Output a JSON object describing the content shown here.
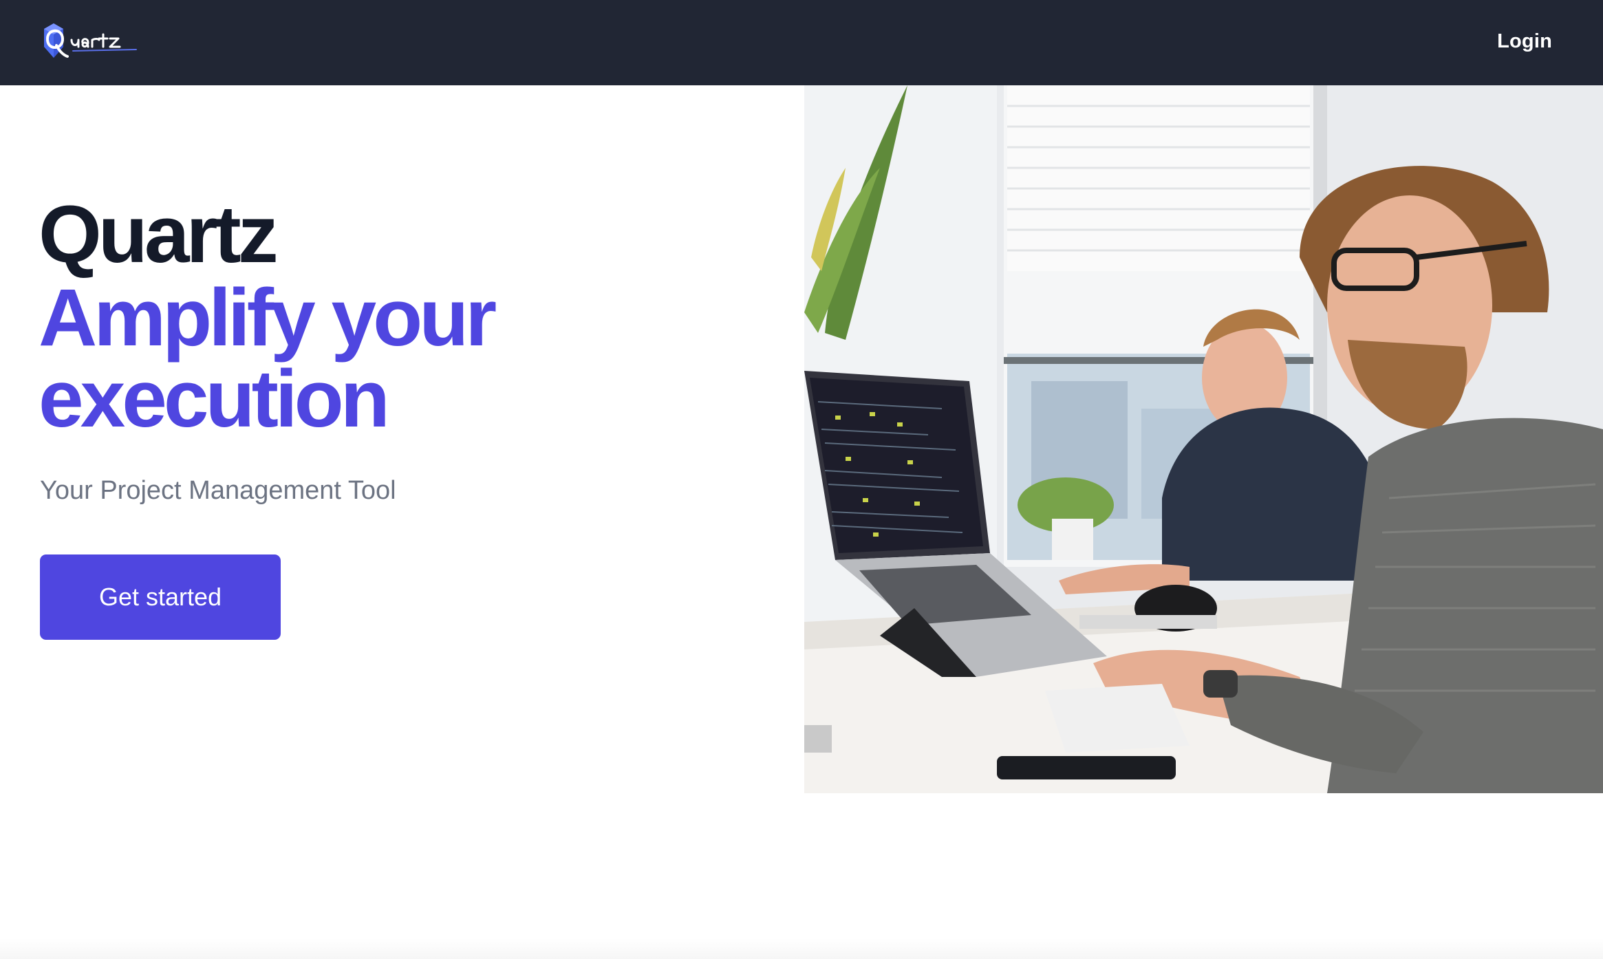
{
  "navbar": {
    "brand": "Quartz",
    "login_label": "Login",
    "background_color": "#212634",
    "logo_icon": "quartz-crystal-logo"
  },
  "hero": {
    "title": "Quartz",
    "tagline": "Amplify your execution",
    "subtitle": "Your Project Management Tool",
    "cta_label": "Get started",
    "accent_color": "#4f46e0",
    "title_color": "#141a29",
    "image": "photo-of-two-developers-working-at-laptops"
  }
}
